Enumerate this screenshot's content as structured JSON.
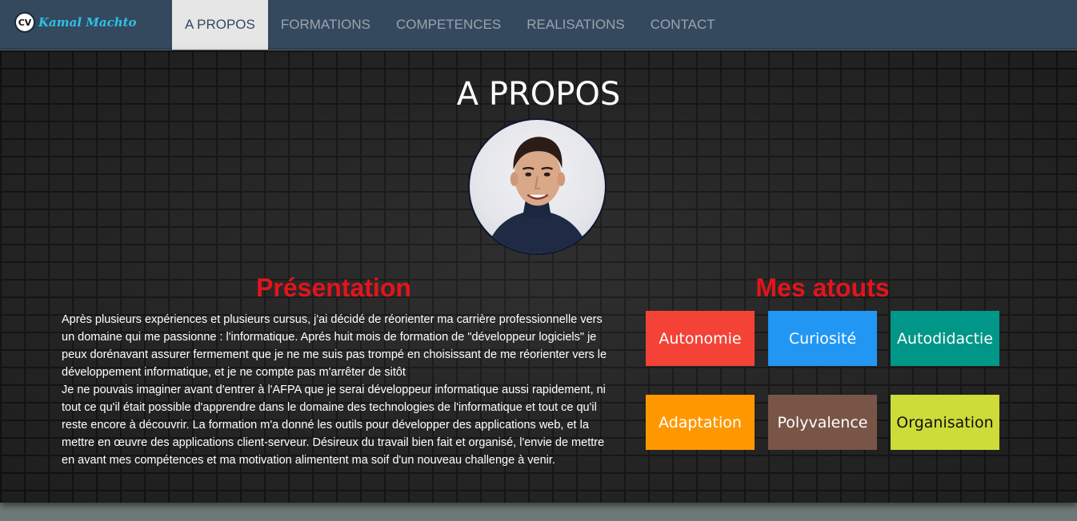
{
  "brand": {
    "badge": "CV",
    "name": "Kamal Machto"
  },
  "nav": {
    "items": [
      {
        "label": "A PROPOS",
        "active": true
      },
      {
        "label": "FORMATIONS",
        "active": false
      },
      {
        "label": "COMPETENCES",
        "active": false
      },
      {
        "label": "REALISATIONS",
        "active": false
      },
      {
        "label": "CONTACT",
        "active": false
      }
    ]
  },
  "main": {
    "title": "A PROPOS",
    "presentation": {
      "heading": "Présentation",
      "paragraph1": "Après plusieurs expériences et plusieurs cursus, j'ai décidé de réorienter ma carrière professionnelle vers un domaine qui me passionne : l'informatique. Aprés huit mois de formation de \"développeur logiciels\" je peux dorénavant assurer fermement que je ne me suis pas trompé en choisissant de me réorienter vers le développement informatique, et je ne compte pas m'arrêter de sitôt",
      "paragraph2": "Je ne pouvais imaginer avant d'entrer à l'AFPA que je serai développeur informatique aussi rapidement, ni tout ce qu'il était possible d'apprendre dans le domaine des technologies de l'informatique et tout ce qu'il reste encore à découvrir. La formation m'a donné les outils pour développer des applications web, et la mettre en œuvre des applications client-serveur. Désireux du travail bien fait et organisé, l'envie de mettre en avant mes compétences et ma motivation alimentent ma soif d'un nouveau challenge à venir."
    },
    "atouts": {
      "heading": "Mes atouts",
      "items": [
        {
          "label": "Autonomie",
          "color": "#f44336",
          "text_color": "#ffffff"
        },
        {
          "label": "Curiosité",
          "color": "#2196f3",
          "text_color": "#ffffff"
        },
        {
          "label": "Autodidactie",
          "color": "#009688",
          "text_color": "#ffffff"
        },
        {
          "label": "Adaptation",
          "color": "#ff9800",
          "text_color": "#ffffff"
        },
        {
          "label": "Polyvalence",
          "color": "#795548",
          "text_color": "#ffffff"
        },
        {
          "label": "Organisation",
          "color": "#cddc39",
          "text_color": "#111111"
        }
      ]
    }
  },
  "colors": {
    "navbar": "#34495e",
    "nav_active_bg": "#e6e6e6",
    "heading_red": "#e3141c",
    "brand_cyan": "#2ec1e6"
  },
  "icons": {
    "avatar": "profile-photo"
  }
}
